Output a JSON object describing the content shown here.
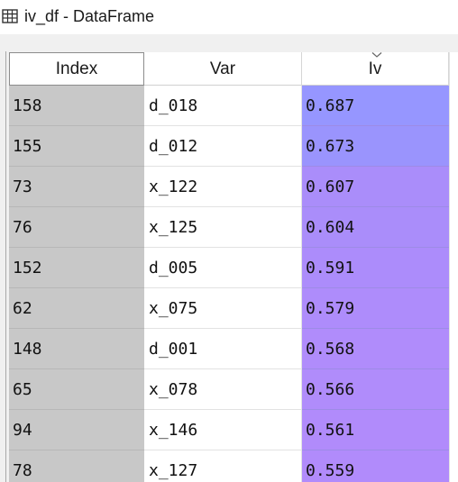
{
  "window": {
    "title": "iv_df - DataFrame",
    "icon": "table-grid-icon"
  },
  "table": {
    "columns": {
      "index": "Index",
      "var": "Var",
      "iv": "Iv"
    },
    "sorted_column": "Iv",
    "sort_indicator_icon": "chevron-down-icon",
    "rows": [
      {
        "index": "158",
        "var": "d_018",
        "iv": "0.687",
        "color": "#9696ff"
      },
      {
        "index": "155",
        "var": "d_012",
        "iv": "0.673",
        "color": "#9a94fd"
      },
      {
        "index": "73",
        "var": "x_122",
        "iv": "0.607",
        "color": "#aa8dfa"
      },
      {
        "index": "76",
        "var": "x_125",
        "iv": "0.604",
        "color": "#aa8dfa"
      },
      {
        "index": "152",
        "var": "d_005",
        "iv": "0.591",
        "color": "#ac8cfb"
      },
      {
        "index": "62",
        "var": "x_075",
        "iv": "0.579",
        "color": "#ae8cfb"
      },
      {
        "index": "148",
        "var": "d_001",
        "iv": "0.568",
        "color": "#b08cfb"
      },
      {
        "index": "65",
        "var": "x_078",
        "iv": "0.566",
        "color": "#b08cfb"
      },
      {
        "index": "94",
        "var": "x_146",
        "iv": "0.561",
        "color": "#b18bfb"
      },
      {
        "index": "78",
        "var": "x_127",
        "iv": "0.559",
        "color": "#b18bfb"
      }
    ]
  }
}
